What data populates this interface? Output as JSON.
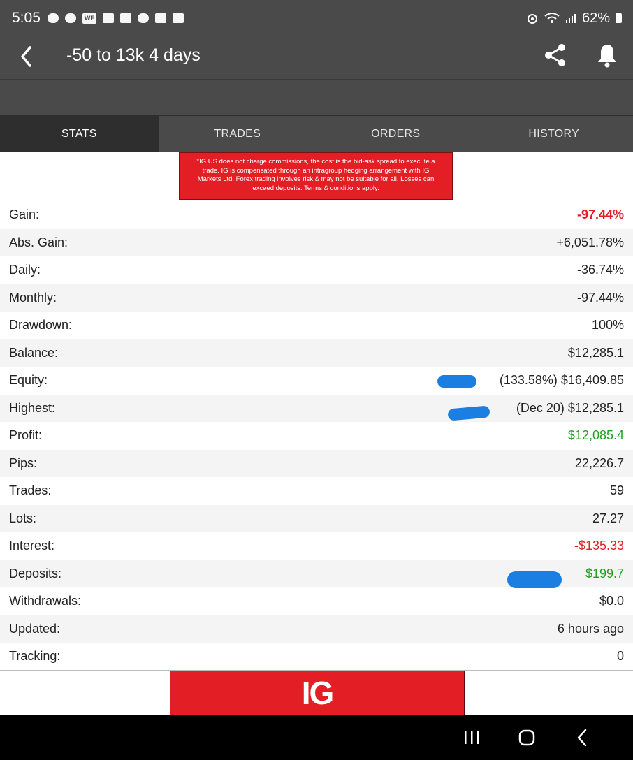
{
  "status_bar": {
    "time": "5:05",
    "wf_icon_text": "WF",
    "battery": "62%"
  },
  "header": {
    "title": "-50  to 13k 4 days"
  },
  "tabs": [
    {
      "label": "STATS",
      "active": true
    },
    {
      "label": "TRADES",
      "active": false
    },
    {
      "label": "ORDERS",
      "active": false
    },
    {
      "label": "HISTORY",
      "active": false
    }
  ],
  "ad_banner": {
    "text": "*IG US does not charge commissions, the cost is the bid-ask spread to execute a trade. IG is compensated through an intragroup hedging arrangement with IG Markets Ltd. Forex trading involves risk & may not be suitable for all. Losses can exceed deposits. Terms & conditions apply."
  },
  "stats": [
    {
      "label": "Gain:",
      "value": "-97.44%",
      "color": "#e31e24"
    },
    {
      "label": "Abs. Gain:",
      "value": "+6,051.78%"
    },
    {
      "label": "Daily:",
      "value": "-36.74%"
    },
    {
      "label": "Monthly:",
      "value": "-97.44%"
    },
    {
      "label": "Drawdown:",
      "value": "100%"
    },
    {
      "label": "Balance:",
      "value": "$12,285.1"
    },
    {
      "label": "Equity:",
      "value": "(133.58%) $16,409.85"
    },
    {
      "label": "Highest:",
      "value": "(Dec 20) $12,285.1"
    },
    {
      "label": "Profit:",
      "value": "$12,085.4",
      "color": "#1ea01e"
    },
    {
      "label": "Pips:",
      "value": "22,226.7"
    },
    {
      "label": "Trades:",
      "value": "59"
    },
    {
      "label": "Lots:",
      "value": "27.27"
    },
    {
      "label": "Interest:",
      "value": "-$135.33",
      "color": "#e31e24"
    },
    {
      "label": "Deposits:",
      "value": "$199.7",
      "color": "#1ea01e"
    },
    {
      "label": "Withdrawals:",
      "value": "$0.0"
    },
    {
      "label": "Updated:",
      "value": "6 hours ago"
    },
    {
      "label": "Tracking:",
      "value": "0"
    }
  ],
  "footer_ad": {
    "logo_text": "IG"
  },
  "colors": {
    "toolbar": "#4a4a4a",
    "active_tab": "#2e2e2e",
    "negative": "#e31e24",
    "positive": "#1ea01e",
    "brand_red": "#e31e24",
    "redaction": "#1a7fe0"
  }
}
